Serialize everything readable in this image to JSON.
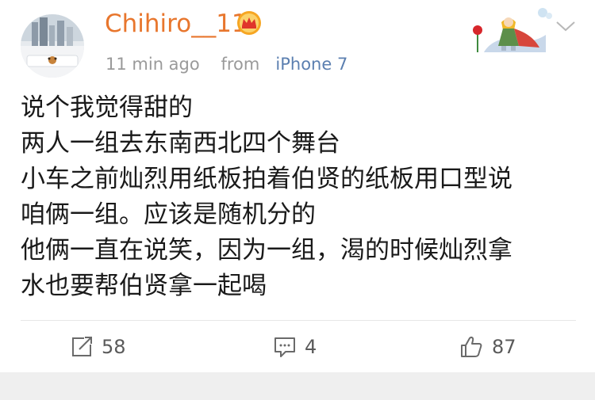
{
  "post": {
    "username": "Chihiro__11",
    "badge_icon": "crown-icon",
    "time_ago": "11 min ago",
    "source_prefix": "from",
    "device": "iPhone 7",
    "text_lines": [
      "说个我觉得甜的",
      "两人一组去东南西北四个舞台",
      "小车之前灿烈用纸板拍着伯贤的纸板用口型说",
      "咱俩一组。应该是随机分的",
      "他俩一直在说笑，因为一组，渴的时候灿烈拿",
      "水也要帮伯贤拿一起喝"
    ]
  },
  "actions": {
    "repost_count": "58",
    "comment_count": "4",
    "like_count": "87"
  },
  "colors": {
    "username": "#e8762d",
    "device_link": "#5b7fb0",
    "meta_text": "#9a9a9a",
    "body_text": "#1a1a1a"
  }
}
